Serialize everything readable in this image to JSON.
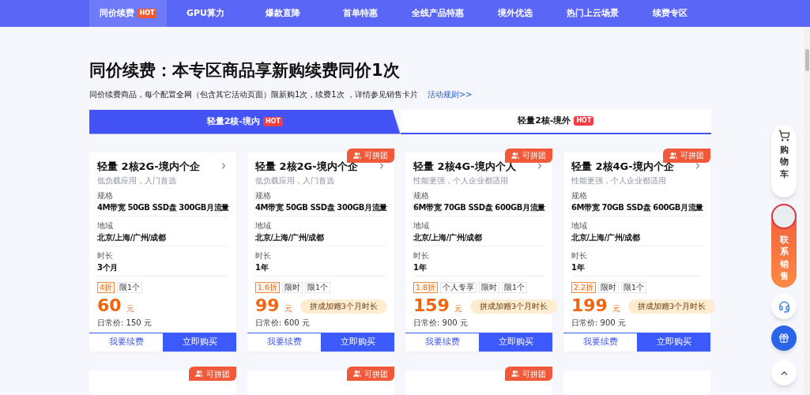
{
  "nav": {
    "items": [
      {
        "label": "同价续费",
        "badge": "HOT",
        "selected": true
      },
      {
        "label": "GPU算力",
        "selected": false
      },
      {
        "label": "爆款直降",
        "selected": false
      },
      {
        "label": "首单特惠",
        "selected": false
      },
      {
        "label": "全线产品特惠",
        "selected": false
      },
      {
        "label": "境外优选",
        "selected": false
      },
      {
        "label": "热门上云场景",
        "selected": false
      },
      {
        "label": "续费专区",
        "selected": false
      }
    ]
  },
  "heading": "同价续费：本专区商品享新购续费同价1次",
  "intro": {
    "text": "同价续费商品，每个配置全网（包含其它活动页面）限新购1次，续费1次 ，详情参见销售卡片",
    "link": "活动规则>>"
  },
  "tabs": [
    {
      "label": "轻量2核-境内",
      "badge": "HOT",
      "selected": true
    },
    {
      "label": "轻量2核-境外",
      "badge": "HOT",
      "selected": false
    }
  ],
  "cards": [
    {
      "title": "轻量 2核2G-境内个企",
      "subtitle": "低负载应用，入门首选",
      "specs": [
        {
          "label": "规格",
          "value": "4M带宽 50GB SSD盘 300GB月流量"
        },
        {
          "label": "地域",
          "value": "北京/上海/广州/成都"
        },
        {
          "label": "时长",
          "value": "3个月"
        }
      ],
      "tags": [
        {
          "text": "4折",
          "kind": "discount"
        },
        {
          "text": "限1个",
          "kind": "plain"
        }
      ],
      "price": "60",
      "unit": "元",
      "regular": "日常价: 150 元",
      "buttons": [
        "我要续费",
        "立即购买"
      ]
    },
    {
      "title": "轻量 2核2G-境内个企",
      "badge": "可拼团",
      "subtitle": "低负载应用，入门首选",
      "specs": [
        {
          "label": "规格",
          "value": "4M带宽 50GB SSD盘 300GB月流量"
        },
        {
          "label": "地域",
          "value": "北京/上海/广州/成都"
        },
        {
          "label": "时长",
          "value": "1年"
        }
      ],
      "tags": [
        {
          "text": "1.6折",
          "kind": "discount"
        },
        {
          "text": "限时",
          "kind": "plain"
        },
        {
          "text": "限1个",
          "kind": "plain"
        }
      ],
      "price": "99",
      "unit": "元",
      "promo": "拼成加赠3个月时长",
      "regular": "日常价: 600 元",
      "buttons": [
        "我要续费",
        "立即购买"
      ]
    },
    {
      "title": "轻量 2核4G-境内个人",
      "badge": "可拼团",
      "subtitle": "性能更强，个人企业都适用",
      "specs": [
        {
          "label": "规格",
          "value": "6M带宽 70GB SSD盘 600GB月流量"
        },
        {
          "label": "地域",
          "value": "北京/上海/广州/成都"
        },
        {
          "label": "时长",
          "value": "1年"
        }
      ],
      "tags": [
        {
          "text": "1.8折",
          "kind": "discount"
        },
        {
          "text": "个人专享",
          "kind": "plain"
        },
        {
          "text": "限时",
          "kind": "plain"
        },
        {
          "text": "限1个",
          "kind": "plain"
        }
      ],
      "price": "159",
      "unit": "元",
      "promo": "拼成加赠3个月时长",
      "regular": "日常价: 900 元",
      "buttons": [
        "我要续费",
        "立即购买"
      ]
    },
    {
      "title": "轻量 2核4G-境内个企",
      "badge": "可拼团",
      "subtitle": "性能更强，个人企业都适用",
      "specs": [
        {
          "label": "规格",
          "value": "6M带宽 70GB SSD盘 600GB月流量"
        },
        {
          "label": "地域",
          "value": "北京/上海/广州/成都"
        },
        {
          "label": "时长",
          "value": "1年"
        }
      ],
      "tags": [
        {
          "text": "2.2折",
          "kind": "discount"
        },
        {
          "text": "限时",
          "kind": "plain"
        },
        {
          "text": "限1个",
          "kind": "plain"
        }
      ],
      "price": "199",
      "unit": "元",
      "promo": "拼成加赠3个月时长",
      "regular": "日常价: 900 元",
      "buttons": [
        "我要续费",
        "立即购买"
      ]
    }
  ],
  "next_cards": [
    {
      "kind": "group_buy",
      "badge": "可拼团"
    },
    {
      "kind": "group_buy",
      "badge": "可拼团"
    },
    {
      "kind": "group_buy",
      "badge": "可拼团"
    },
    {
      "kind": "plain"
    }
  ],
  "sidebar": {
    "cart": "购物车",
    "contact": "联系销售"
  }
}
